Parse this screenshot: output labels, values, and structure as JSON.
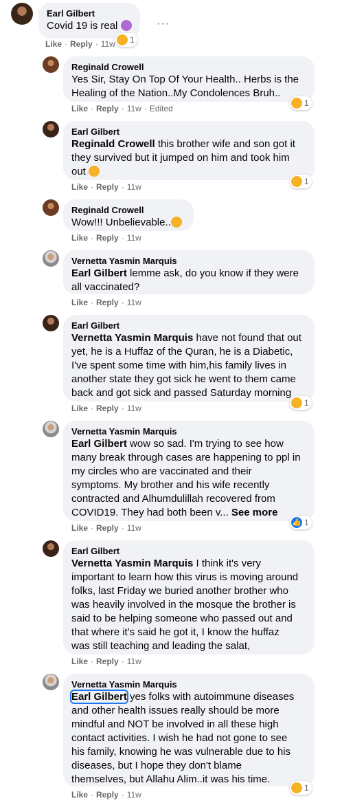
{
  "comments": [
    {
      "author": "Earl Gilbert",
      "text": "Covid 19 is real",
      "actions": {
        "like": "Like",
        "reply": "Reply",
        "time": "11w"
      },
      "reaction_count": "1"
    },
    {
      "author": "Reginald Crowell",
      "lines": [
        "Yes Sir, Stay On Top Of Your Health.. Herbs is the",
        "Healing of the Nation..My Condolences Bruh.."
      ],
      "actions": {
        "like": "Like",
        "reply": "Reply",
        "time": "11w",
        "edited": "Edited"
      },
      "reaction_count": "1"
    },
    {
      "author": "Earl Gilbert",
      "tag": "Reginald Crowell",
      "lines": [
        "this brother wife and son got it",
        "they survived but it jumped on him and took him",
        "out"
      ],
      "actions": {
        "like": "Like",
        "reply": "Reply",
        "time": "11w"
      },
      "reaction_count": "1"
    },
    {
      "author": "Reginald Crowell",
      "text": "Wow!!! Unbelievable..",
      "actions": {
        "like": "Like",
        "reply": "Reply",
        "time": "11w"
      }
    },
    {
      "author": "Vernetta Yasmin Marquis",
      "tag": "Earl Gilbert",
      "lines": [
        "lemme ask, do you know if they were",
        "all vaccinated?"
      ],
      "actions": {
        "like": "Like",
        "reply": "Reply",
        "time": "11w"
      }
    },
    {
      "author": "Earl Gilbert",
      "tag": "Vernetta Yasmin Marquis",
      "lines": [
        "have not found that out",
        "yet, he is a Huffaz of the Quran, he is a Diabetic,",
        "I've spent some time with him,his family lives in",
        "another state they got sick he went to them came",
        "back and got sick and passed Saturday morning"
      ],
      "actions": {
        "like": "Like",
        "reply": "Reply",
        "time": "11w"
      },
      "reaction_count": "1"
    },
    {
      "author": "Vernetta Yasmin Marquis",
      "tag": "Earl Gilbert",
      "lines": [
        "wow so sad. I'm trying to see how",
        "many break through cases are happening to ppl in",
        "my circles who are vaccinated and their",
        "symptoms. My brother and his wife recently",
        "contracted and Alhumdulillah recovered from",
        "COVID19. They had both been v..."
      ],
      "see_more": "See more",
      "actions": {
        "like": "Like",
        "reply": "Reply",
        "time": "11w"
      },
      "reaction_count": "1"
    },
    {
      "author": "Earl Gilbert",
      "tag": "Vernetta Yasmin Marquis",
      "lines": [
        "I think it's very",
        "important to learn how this virus is moving around",
        "folks, last Friday we buried another brother who",
        "was heavily involved in the mosque the brother is",
        "said to be helping someone who passed out and",
        "that where it's said he got it, I know the huffaz",
        "was still teaching and leading the salat,"
      ],
      "actions": {
        "like": "Like",
        "reply": "Reply",
        "time": "11w"
      }
    },
    {
      "author": "Vernetta Yasmin Marquis",
      "tag": "Earl Gilbert",
      "lines": [
        "yes folks with autoimmune diseases",
        "and other health issues really should be more",
        "mindful and NOT be involved in all these high",
        "contact activities. I wish he had not gone to see",
        "his family, knowing he was vulnerable due to his",
        "diseases, but I hope they don't blame",
        "themselves, but Allahu Alim..it was his time."
      ],
      "actions": {
        "like": "Like",
        "reply": "Reply",
        "time": "11w"
      },
      "reaction_count": "1"
    }
  ],
  "more_options": "···"
}
